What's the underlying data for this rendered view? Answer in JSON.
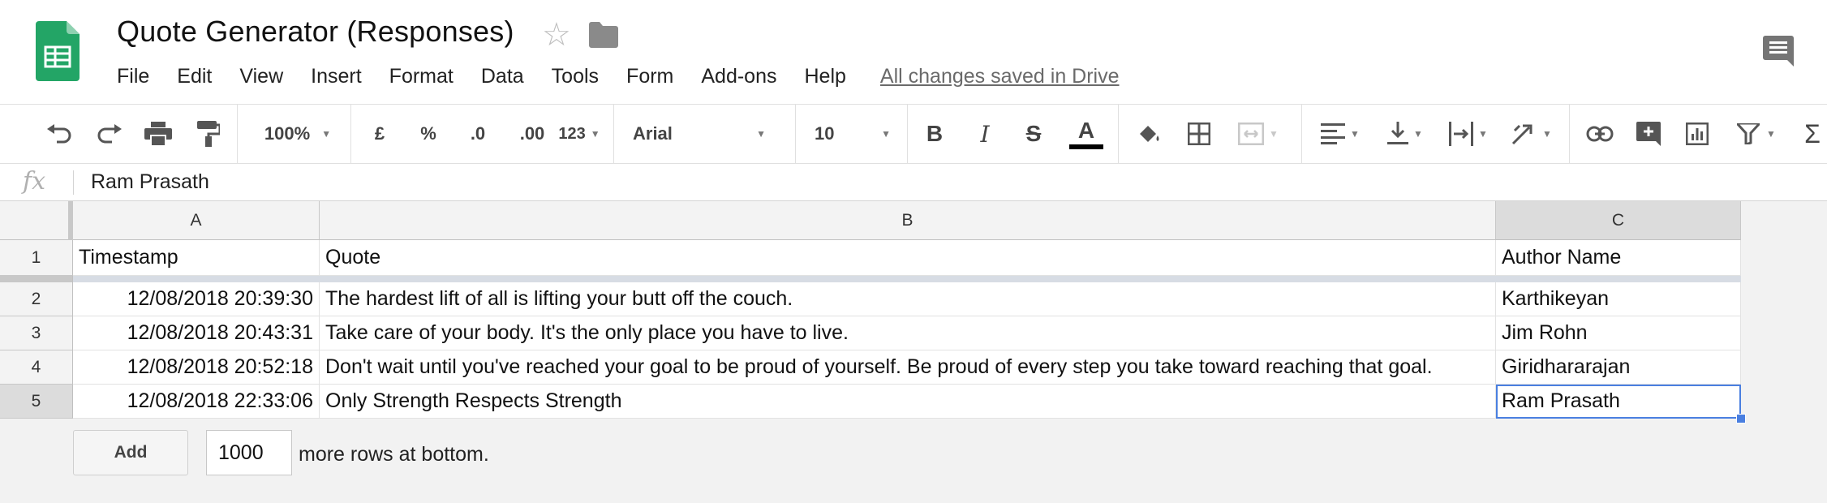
{
  "doc": {
    "title": "Quote Generator (Responses)"
  },
  "menu": [
    "File",
    "Edit",
    "View",
    "Insert",
    "Format",
    "Data",
    "Tools",
    "Form",
    "Add-ons",
    "Help"
  ],
  "save_status": "All changes saved in Drive",
  "toolbar": {
    "zoom": "100%",
    "currency": "£",
    "percent": "%",
    "decrease_decimal": ".0",
    "increase_decimal": ".00",
    "more_formats": "123",
    "font": "Arial",
    "font_size": "10",
    "bold": "B",
    "italic": "I",
    "strikethrough": "S",
    "text_color": "A",
    "text_color_swatch": "#000000"
  },
  "formula_bar": {
    "fx": "fx",
    "value": "Ram Prasath"
  },
  "columns": [
    "A",
    "B",
    "C"
  ],
  "rows": [
    {
      "num": "1",
      "a": "Timestamp",
      "b": "Quote",
      "c": "Author Name"
    },
    {
      "num": "2",
      "a": "12/08/2018 20:39:30",
      "b": "The hardest lift of all is lifting your butt off the couch.",
      "c": "Karthikeyan"
    },
    {
      "num": "3",
      "a": "12/08/2018 20:43:31",
      "b": "Take care of your body. It's the only place you have to live.",
      "c": "Jim Rohn"
    },
    {
      "num": "4",
      "a": "12/08/2018 20:52:18",
      "b": "Don't wait until you've reached your goal to be proud of yourself. Be proud of every step you take toward reaching that goal.",
      "c": "Giridhararajan"
    },
    {
      "num": "5",
      "a": "12/08/2018 22:33:06",
      "b": "Only Strength Respects Strength",
      "c": "Ram Prasath"
    }
  ],
  "selected_cell": "C5",
  "add_rows": {
    "button": "Add",
    "count": "1000",
    "suffix": "more rows at bottom."
  },
  "colors": {
    "sheets_green": "#23a566",
    "selection_blue": "#4a7fe0",
    "freeze_bar": "#d7dce4"
  }
}
